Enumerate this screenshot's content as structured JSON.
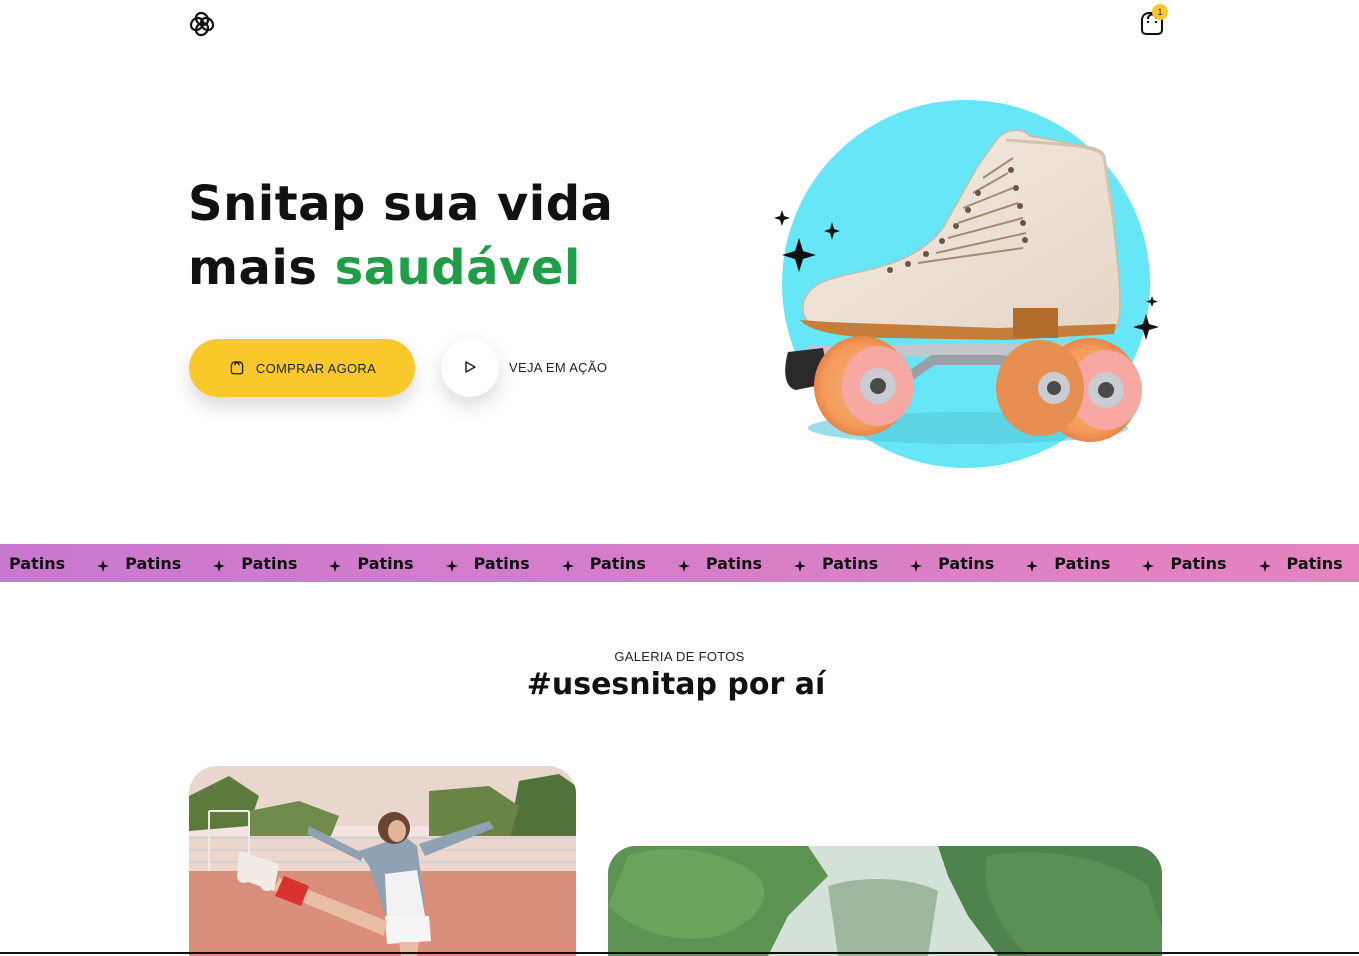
{
  "header": {
    "logo_icon": "snitap-logo-icon",
    "cart_icon": "shopping-bag-icon",
    "cart_count": "1"
  },
  "hero": {
    "title_line1": "Snitap sua vida",
    "title_line2_plain": "mais ",
    "title_line2_accent": "saudável",
    "buy_button_label": "COMPRAR AGORA",
    "buy_button_icon": "shopping-bag-icon",
    "play_button_icon": "play-icon",
    "play_label": "VEJA EM AÇÃO",
    "image_description_icon": "roller-skate-illustration"
  },
  "marquee": {
    "items": [
      "Patins",
      "Patins",
      "Patins",
      "Patins",
      "Patins",
      "Patins",
      "Patins",
      "Patins",
      "Patins",
      "Patins",
      "Patins",
      "Patins",
      "Patins"
    ],
    "separator_icon": "sparkle-icon"
  },
  "gallery": {
    "kicker": "GALERIA DE FOTOS",
    "title": "#usesnitap por aí"
  },
  "colors": {
    "accent_green": "#1f9d47",
    "button_yellow": "#f9c82b",
    "hero_circle": "#66e6f6",
    "marquee_pink": "#d97fc8"
  }
}
